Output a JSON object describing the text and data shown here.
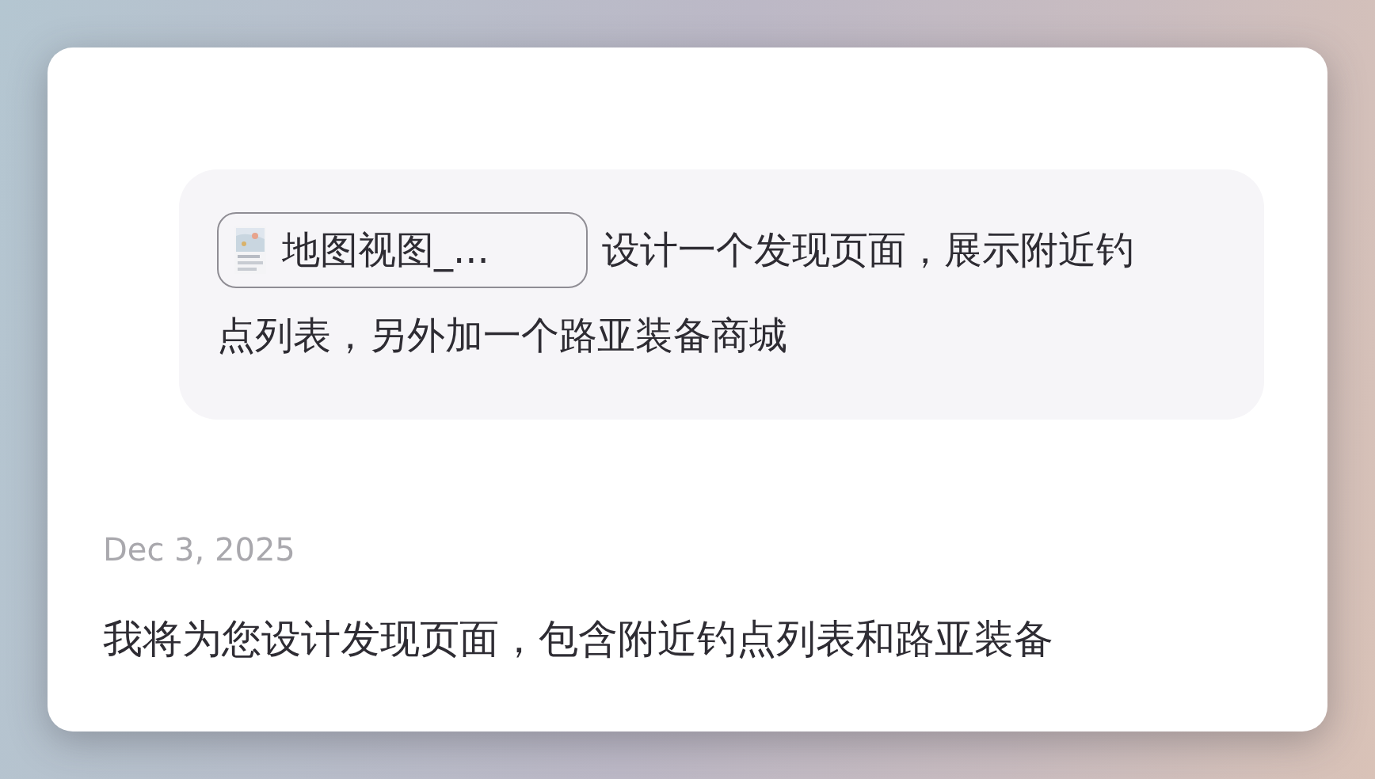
{
  "user_message": {
    "attachment": {
      "kind": "picture",
      "label": "地图视图_..."
    },
    "text_lines": [
      "设计一个发现页面，展示附近钓",
      "点列表，另外加一个路亚装备商城"
    ]
  },
  "reply": {
    "date": "Dec 3, 2025",
    "text": "我将为您设计发现页面，包含附近钓点列表和路亚装备"
  }
}
